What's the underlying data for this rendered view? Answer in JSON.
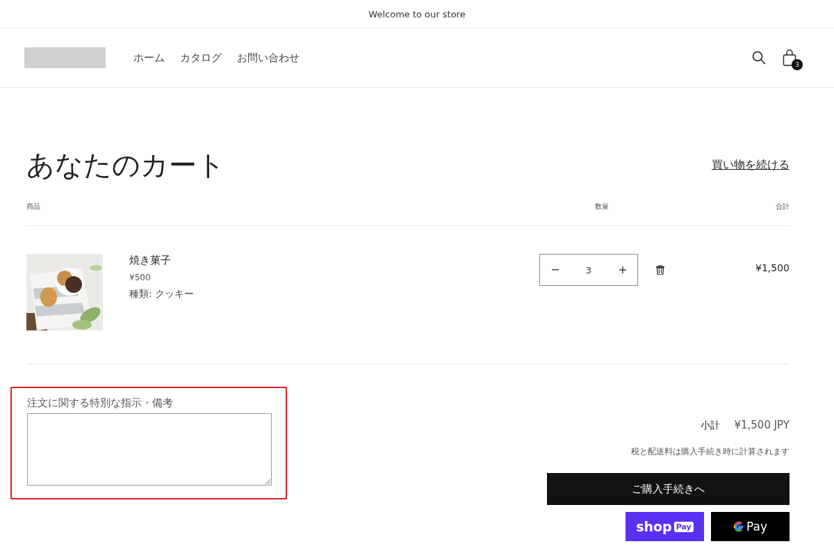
{
  "announcement": "Welcome to our store",
  "nav": [
    {
      "label": "ホーム"
    },
    {
      "label": "カタログ"
    },
    {
      "label": "お問い合わせ"
    }
  ],
  "cart_count": "3",
  "title": "あなたのカート",
  "continue_link": "買い物を続ける",
  "columns": [
    "商品",
    "数量",
    "合計"
  ],
  "items": [
    {
      "name": "焼き菓子",
      "price": "¥500",
      "variant": "種類: クッキー",
      "quantity": "3",
      "total": "¥1,500"
    }
  ],
  "note": {
    "label": "注文に関する特別な指示・備考",
    "highlighted": true
  },
  "subtotal": {
    "label": "小計",
    "value": "¥1,500 JPY"
  },
  "tax_note": "税と配送料は購入手続き時に計算されます",
  "checkout_button": "ご購入手続きへ",
  "shop_pay": {
    "word": "shop",
    "badge": "Pay"
  },
  "google_pay": {
    "label": "Pay"
  }
}
